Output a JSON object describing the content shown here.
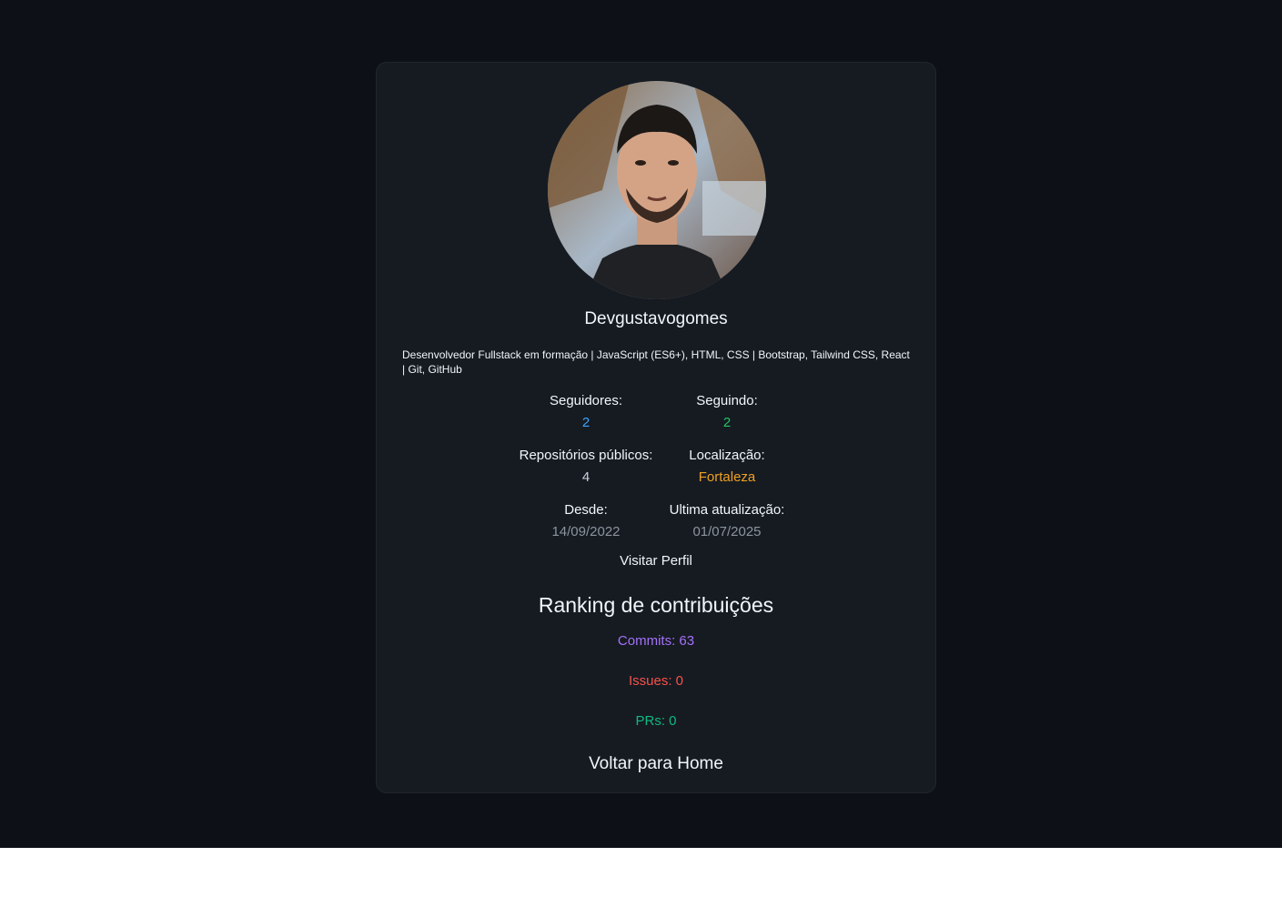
{
  "profile": {
    "name": "Devgustavogomes",
    "bio": "Desenvolvedor Fullstack em formação | JavaScript (ES6+), HTML, CSS | Bootstrap, Tailwind CSS, React | Git, GitHub"
  },
  "stats": {
    "followers": {
      "label": "Seguidores:",
      "value": "2"
    },
    "following": {
      "label": "Seguindo:",
      "value": "2"
    },
    "repos": {
      "label": "Repositórios públicos:",
      "value": "4"
    },
    "location": {
      "label": "Localização:",
      "value": "Fortaleza"
    },
    "since": {
      "label": "Desde:",
      "value": "14/09/2022"
    },
    "updated": {
      "label": "Ultima atualização:",
      "value": "01/07/2025"
    }
  },
  "actions": {
    "visit_profile": "Visitar Perfil",
    "back_home": "Voltar para Home"
  },
  "ranking": {
    "title": "Ranking de contribuições",
    "commits": "Commits: 63",
    "issues": "Issues: 0",
    "prs": "PRs: 0"
  },
  "colors": {
    "page_bg": "#0d1117",
    "card_bg": "#161b22",
    "followers": "#3ba3ff",
    "following": "#22c55e",
    "repos": "#c9d1d9",
    "location": "#f0a020",
    "dates": "#8b949e",
    "commits": "#a371f7",
    "issues": "#f85149",
    "prs": "#10b981"
  }
}
